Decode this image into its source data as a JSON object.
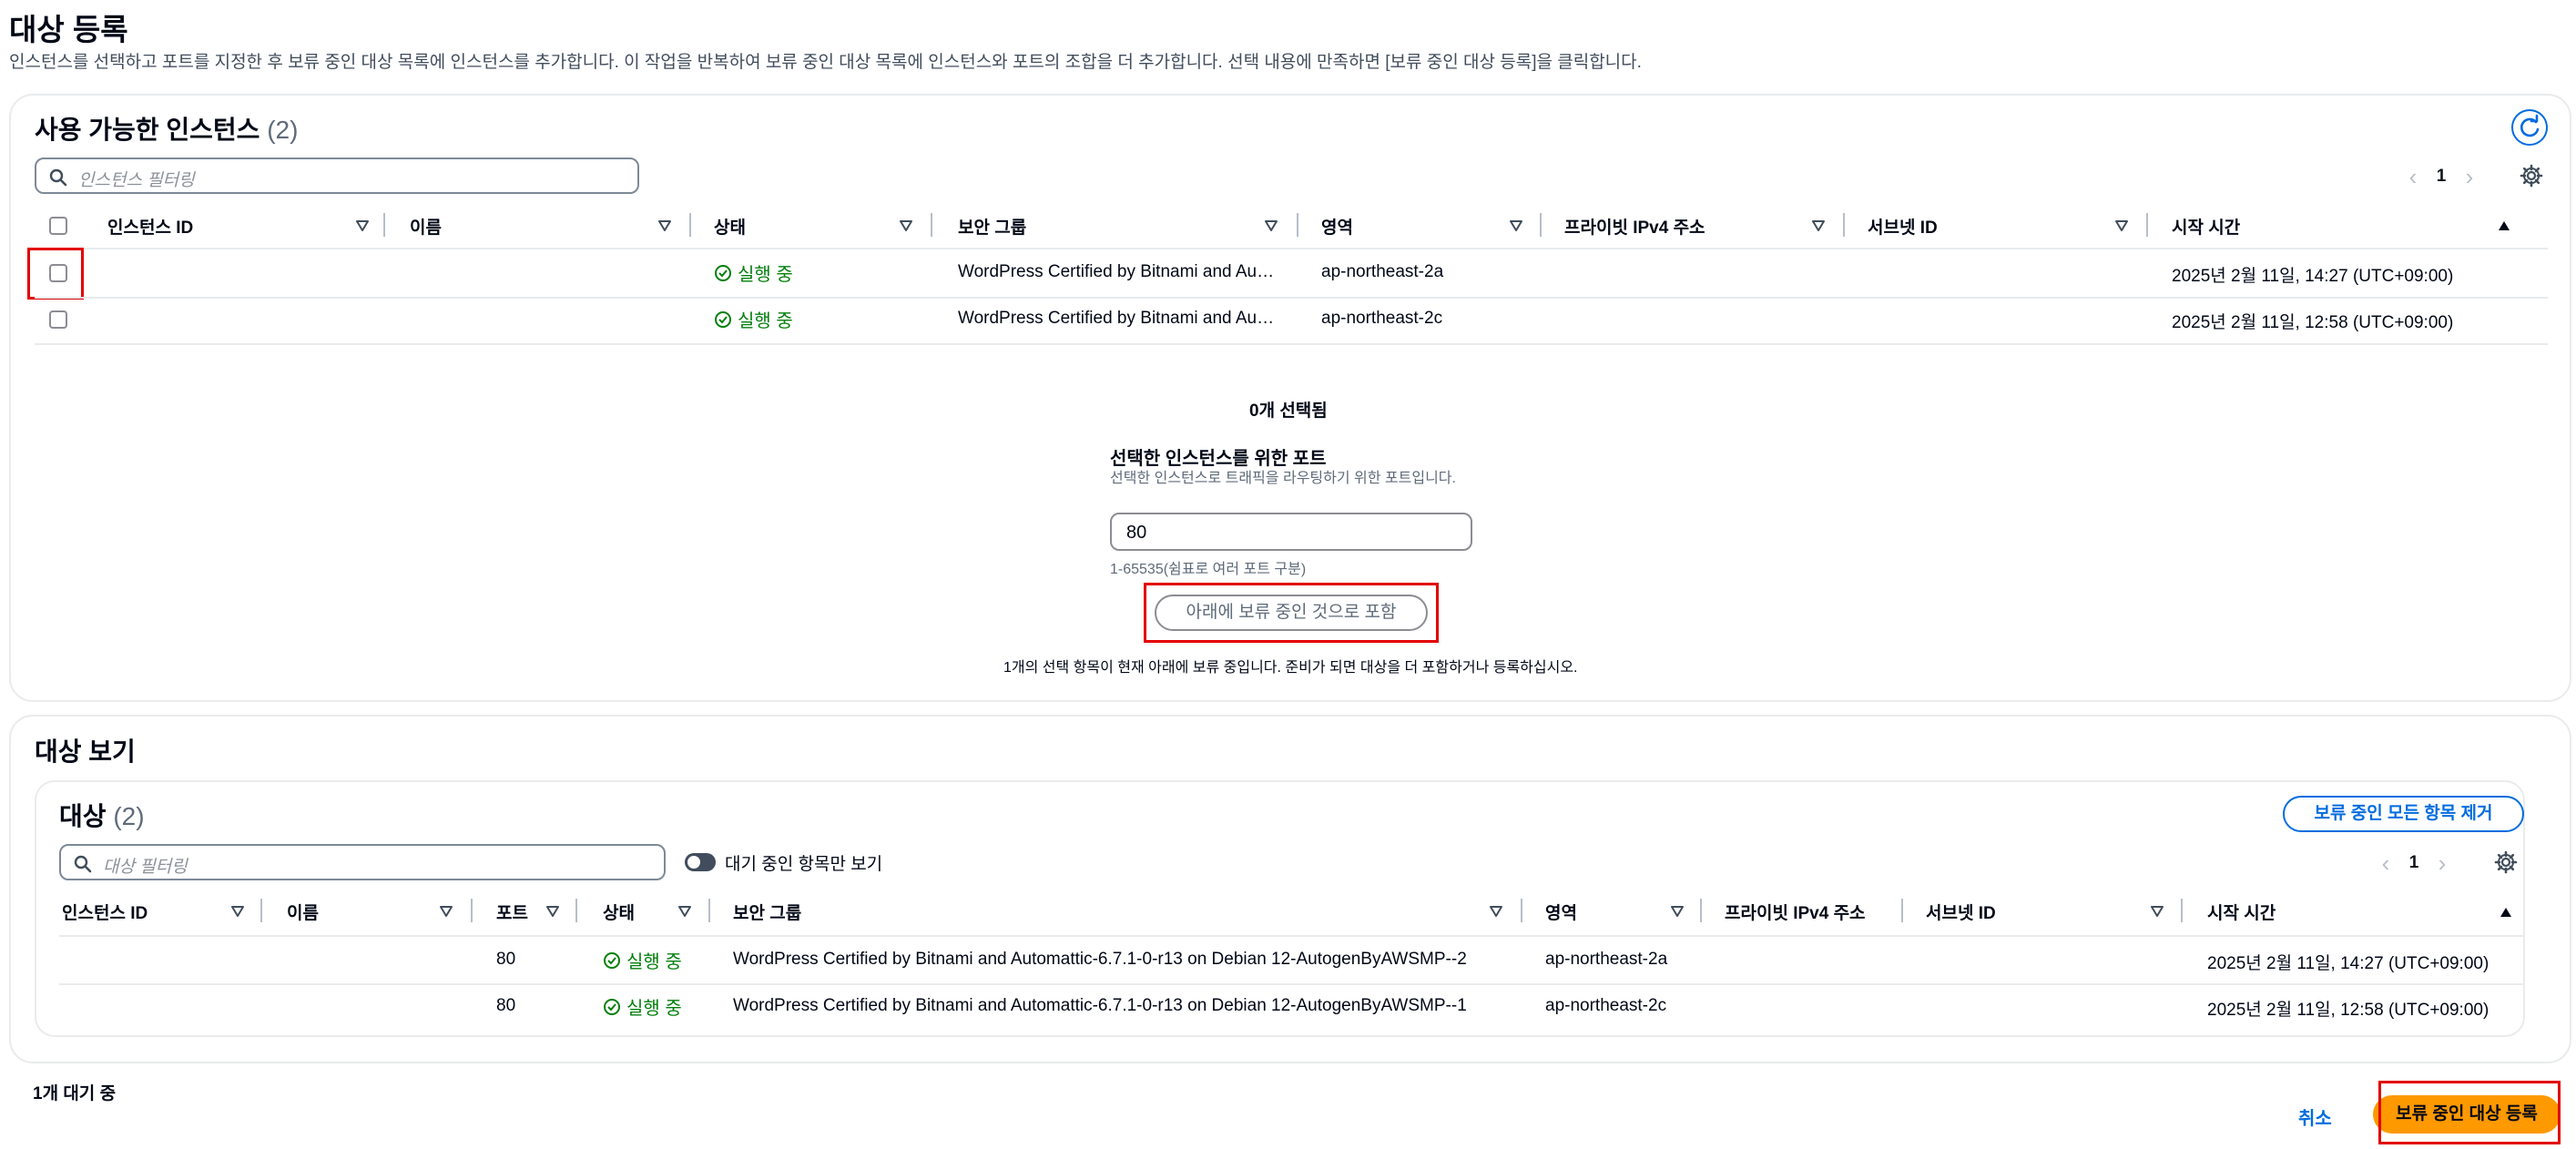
{
  "page": {
    "title": "대상 등록",
    "description": "인스턴스를 선택하고 포트를 지정한 후 보류 중인 대상 목록에 인스턴스를 추가합니다. 이 작업을 반복하여 보류 중인 대상 목록에 인스턴스와 포트의 조합을 더 추가합니다. 선택 내용에 만족하면 [보류 중인 대상 등록]을 클릭합니다."
  },
  "available": {
    "title": "사용 가능한 인스턴스",
    "count": "(2)",
    "filter_placeholder": "인스턴스 필터링",
    "page": "1",
    "columns": [
      "인스턴스 ID",
      "이름",
      "상태",
      "보안 그룹",
      "영역",
      "프라이빗 IPv4 주소",
      "서브넷 ID",
      "시작 시간"
    ],
    "rows": [
      {
        "instance_id": "",
        "name": "",
        "status": "실행 중",
        "security_group": "WordPress Certified by Bitnami and Au…",
        "zone": "ap-northeast-2a",
        "private_ip": "",
        "subnet_id": "",
        "launch_time": "2025년 2월 11일, 14:27 (UTC+09:00)"
      },
      {
        "instance_id": "",
        "name": "",
        "status": "실행 중",
        "security_group": "WordPress Certified by Bitnami and Au…",
        "zone": "ap-northeast-2c",
        "private_ip": "",
        "subnet_id": "",
        "launch_time": "2025년 2월 11일, 12:58 (UTC+09:00)"
      }
    ],
    "selected_count": "0개 선택됨",
    "port_label": "선택한 인스턴스를 위한 포트",
    "port_description": "선택한 인스턴스로 트래픽을 라우팅하기 위한 포트입니다.",
    "port_value": "80",
    "port_hint": "1-65535(쉼표로 여러 포트 구분)",
    "include_button": "아래에 보류 중인 것으로 포함",
    "pending_note": "1개의 선택 항목이 현재 아래에 보류 중입니다. 준비가 되면 대상을 더 포함하거나 등록하십시오."
  },
  "review": {
    "title": "대상 보기",
    "targets_title": "대상",
    "targets_count": "(2)",
    "remove_all_button": "보류 중인 모든 항목 제거",
    "filter_placeholder": "대상 필터링",
    "toggle_label": "대기 중인 항목만 보기",
    "page": "1",
    "columns": [
      "인스턴스 ID",
      "이름",
      "포트",
      "상태",
      "보안 그룹",
      "영역",
      "프라이빗 IPv4 주소",
      "서브넷 ID",
      "시작 시간"
    ],
    "rows": [
      {
        "instance_id": "",
        "name": "",
        "port": "80",
        "status": "실행 중",
        "security_group": "WordPress Certified by Bitnami and Automattic-6.7.1-0-r13 on Debian 12-AutogenByAWSMP--2",
        "zone": "ap-northeast-2a",
        "private_ip": "",
        "subnet_id": "",
        "launch_time": "2025년 2월 11일, 14:27 (UTC+09:00)"
      },
      {
        "instance_id": "",
        "name": "",
        "port": "80",
        "status": "실행 중",
        "security_group": "WordPress Certified by Bitnami and Automattic-6.7.1-0-r13 on Debian 12-AutogenByAWSMP--1",
        "zone": "ap-northeast-2c",
        "private_ip": "",
        "subnet_id": "",
        "launch_time": "2025년 2월 11일, 12:58 (UTC+09:00)"
      }
    ]
  },
  "footer": {
    "pending_count": "1개 대기 중",
    "cancel_button": "취소",
    "register_button": "보류 중인 대상 등록"
  },
  "colors": {
    "accent": "#006ce0",
    "primary_button": "#ff9900",
    "success": "#037f0c",
    "highlight_box": "#e30000"
  },
  "icons": [
    "search-icon",
    "refresh-icon",
    "settings-gear-icon",
    "chevron-left-icon",
    "chevron-right-icon",
    "status-ok-icon",
    "sort-descending-icon",
    "sort-ascending-icon"
  ]
}
